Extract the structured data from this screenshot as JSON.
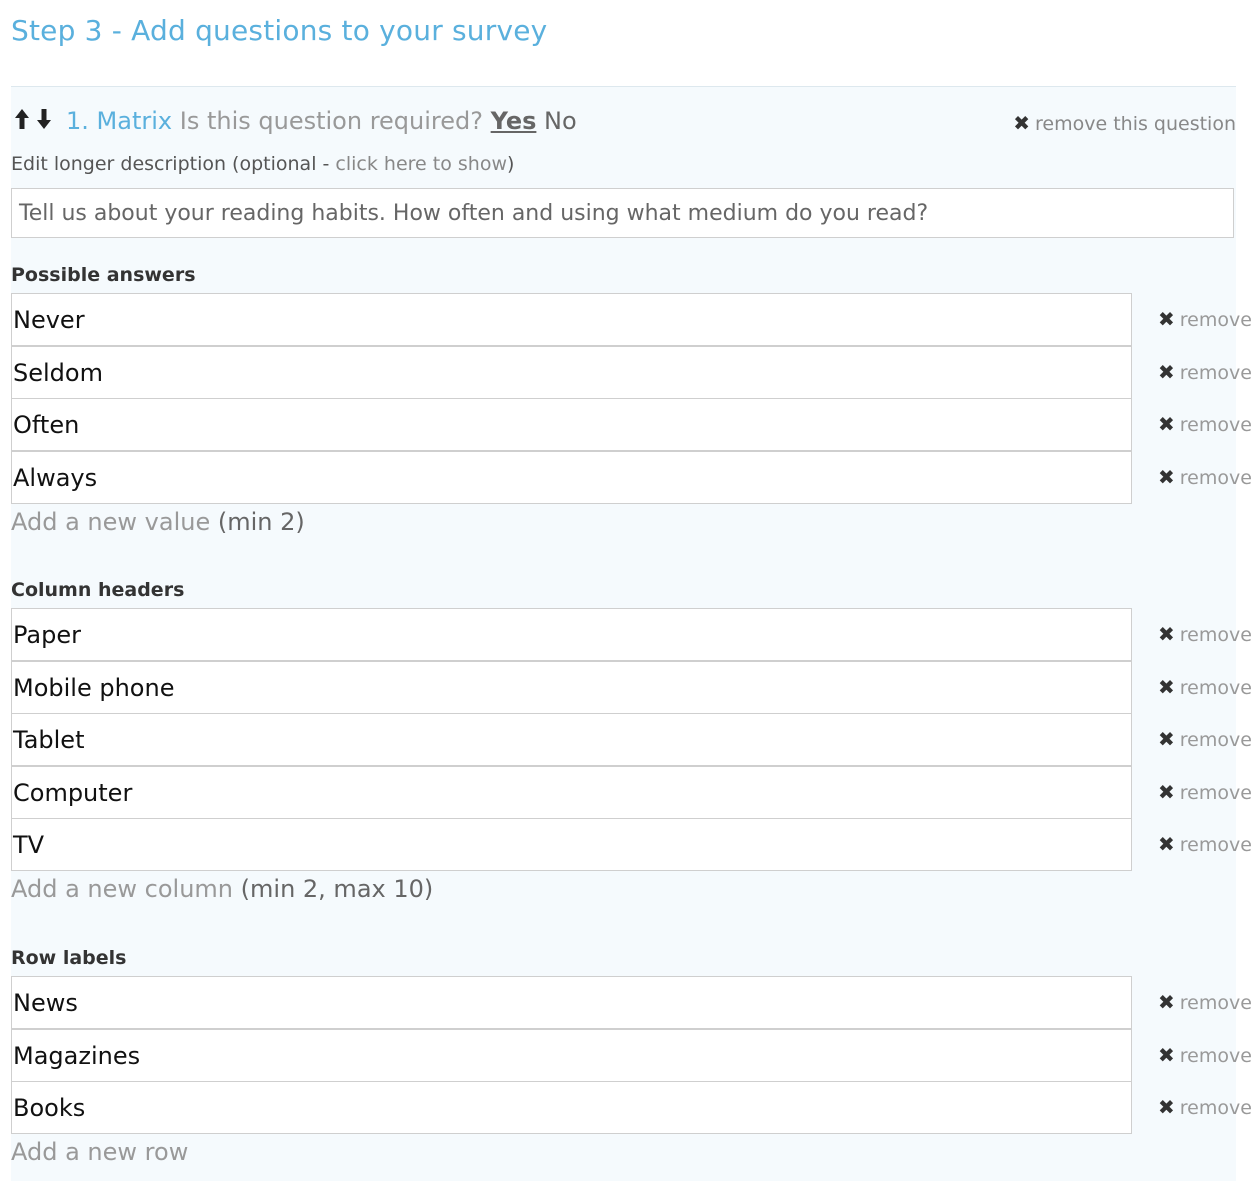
{
  "step_title": "Step 3 - Add questions to your survey",
  "question": {
    "number": "1.",
    "type": "Matrix",
    "required_prompt": "Is this question required?",
    "required_yes": "Yes",
    "required_no": "No",
    "remove_label": "remove this question",
    "desc_prefix": "Edit longer description (optional - ",
    "desc_link": "click here to show",
    "desc_suffix": ")",
    "description": "Tell us about your reading habits. How often and using what medium do you read?"
  },
  "icons": {
    "up": "arrow-up-icon",
    "down": "arrow-down-icon",
    "remove": "close-icon"
  },
  "remove_label": "remove",
  "sections": {
    "answers": {
      "title": "Possible answers",
      "items": [
        "Never",
        "Seldom",
        "Often",
        "Always"
      ],
      "add_link": "Add a new value",
      "add_hint": "(min 2)"
    },
    "columns": {
      "title": "Column headers",
      "items": [
        "Paper",
        "Mobile phone",
        "Tablet",
        "Computer",
        "TV"
      ],
      "add_link": "Add a new column",
      "add_hint": "(min 2, max 10)"
    },
    "rows": {
      "title": "Row labels",
      "items": [
        "News",
        "Magazines",
        "Books"
      ],
      "add_link": "Add a new row",
      "add_hint": ""
    }
  }
}
